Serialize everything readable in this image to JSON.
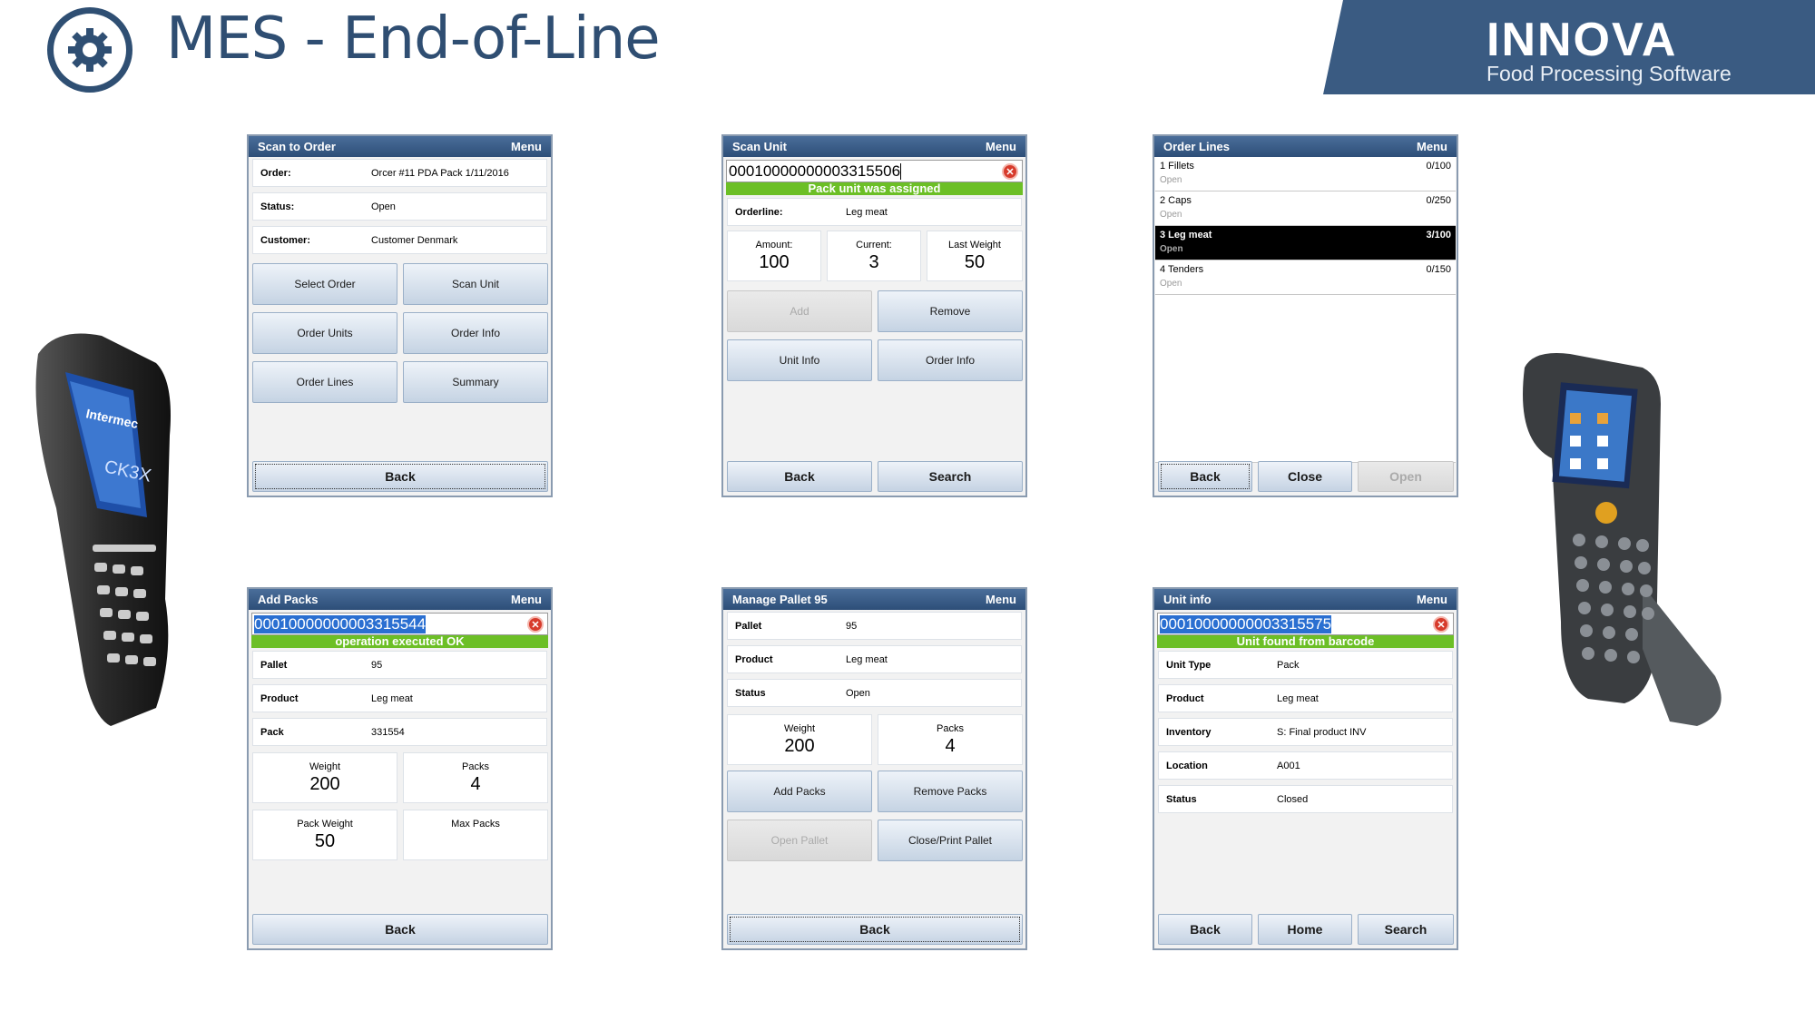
{
  "header": {
    "title": "MES - End-of-Line",
    "brand": "INNOVA",
    "tagline": "Food Processing Software"
  },
  "s1": {
    "title": "Scan to Order",
    "menu": "Menu",
    "fields": [
      {
        "k": "Order:",
        "v": "Orcer #11 PDA Pack 1/11/2016"
      },
      {
        "k": "Status:",
        "v": "Open"
      },
      {
        "k": "Customer:",
        "v": "Customer Denmark"
      }
    ],
    "buttons": [
      "Select Order",
      "Scan Unit",
      "Order Units",
      "Order Info",
      "Order Lines",
      "Summary"
    ],
    "back": "Back"
  },
  "s2": {
    "title": "Scan Unit",
    "menu": "Menu",
    "barcode": "00010000000003315506",
    "msg": "Pack unit was assigned",
    "orderline_k": "Orderline:",
    "orderline_v": "Leg meat",
    "amount_l": "Amount:",
    "amount": "100",
    "current_l": "Current:",
    "current": "3",
    "lastw_l": "Last Weight",
    "lastw": "50",
    "add": "Add",
    "remove": "Remove",
    "unitinfo": "Unit Info",
    "orderinfo": "Order Info",
    "back": "Back",
    "search": "Search"
  },
  "s3": {
    "title": "Order Lines",
    "menu": "Menu",
    "lines": [
      {
        "n": "1 Fillets",
        "q": "0/100",
        "s": "Open"
      },
      {
        "n": "2 Caps",
        "q": "0/250",
        "s": "Open"
      },
      {
        "n": "3 Leg meat",
        "q": "3/100",
        "s": "Open"
      },
      {
        "n": "4 Tenders",
        "q": "0/150",
        "s": "Open"
      }
    ],
    "back": "Back",
    "close": "Close",
    "open": "Open"
  },
  "s4": {
    "title": "Add Packs",
    "menu": "Menu",
    "barcode": "00010000000003315544",
    "msg": "operation executed OK",
    "fields": [
      {
        "k": "Pallet",
        "v": "95"
      },
      {
        "k": "Product",
        "v": "Leg meat"
      },
      {
        "k": "Pack",
        "v": "331554"
      }
    ],
    "weight_l": "Weight",
    "weight": "200",
    "packs_l": "Packs",
    "packs": "4",
    "pw_l": "Pack Weight",
    "pw": "50",
    "mp_l": "Max Packs",
    "back": "Back"
  },
  "s5": {
    "title": "Manage Pallet 95",
    "menu": "Menu",
    "fields": [
      {
        "k": "Pallet",
        "v": "95"
      },
      {
        "k": "Product",
        "v": "Leg meat"
      },
      {
        "k": "Status",
        "v": "Open"
      }
    ],
    "weight_l": "Weight",
    "weight": "200",
    "packs_l": "Packs",
    "packs": "4",
    "addpacks": "Add Packs",
    "removepacks": "Remove Packs",
    "openpallet": "Open Pallet",
    "closeprint": "Close/Print Pallet",
    "back": "Back"
  },
  "s6": {
    "title": "Unit info",
    "menu": "Menu",
    "barcode": "00010000000003315575",
    "msg": "Unit found from barcode",
    "fields": [
      {
        "k": "Unit Type",
        "v": "Pack"
      },
      {
        "k": "Product",
        "v": "Leg meat"
      },
      {
        "k": "Inventory",
        "v": "S: Final product INV"
      },
      {
        "k": "Location",
        "v": "A001"
      },
      {
        "k": "Status",
        "v": "Closed"
      }
    ],
    "back": "Back",
    "home": "Home",
    "search": "Search"
  },
  "devices": {
    "d1_brand": "Intermec",
    "d1_model": "CK3X"
  }
}
